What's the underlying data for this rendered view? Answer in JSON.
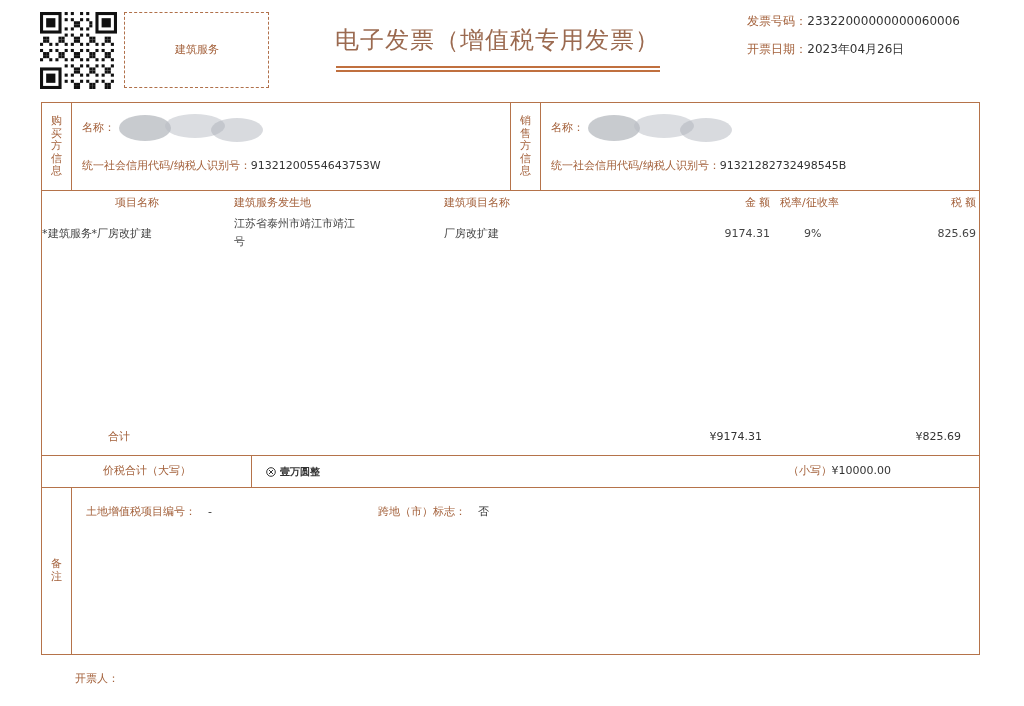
{
  "header": {
    "category_box": "建筑服务",
    "title": "电子发票（增值税专用发票）",
    "invoice_number_label": "发票号码：",
    "invoice_number": "23322000000000060006",
    "issue_date_label": "开票日期：",
    "issue_date": "2023年04月26日"
  },
  "buyer": {
    "side_label": "购买方信息",
    "name_label": "名称：",
    "tax_id_label": "统一社会信用代码/纳税人识别号：",
    "tax_id": "91321200554643753W"
  },
  "seller": {
    "side_label": "销售方信息",
    "name_label": "名称：",
    "tax_id_label": "统一社会信用代码/纳税人识别号：",
    "tax_id": "91321282732498545B"
  },
  "items": {
    "columns": [
      "项目名称",
      "建筑服务发生地",
      "建筑项目名称",
      "金 额",
      "税率/征收率",
      "税 额"
    ],
    "rows": [
      {
        "cells": [
          [
            "*建筑服务*厂房改扩建"
          ],
          [
            "江苏省泰州市靖江市靖江",
            "号"
          ],
          [
            "厂房改扩建"
          ],
          [
            "9174.31"
          ],
          [
            "9%"
          ],
          [
            "825.69"
          ]
        ]
      }
    ],
    "total_label": "合计",
    "total_amount": "¥9174.31",
    "total_tax": "¥825.69"
  },
  "grand_total": {
    "label": "价税合计（大写）",
    "words": "壹万圆整",
    "small_label": "（小写）",
    "small_value": "¥10000.00"
  },
  "remarks": {
    "side_label": "备注",
    "entries": [
      {
        "label": "土地增值税项目编号：",
        "value": "-"
      },
      {
        "label": "跨地（市）标志：",
        "value": "否"
      }
    ]
  },
  "issuer": {
    "label": "开票人："
  }
}
